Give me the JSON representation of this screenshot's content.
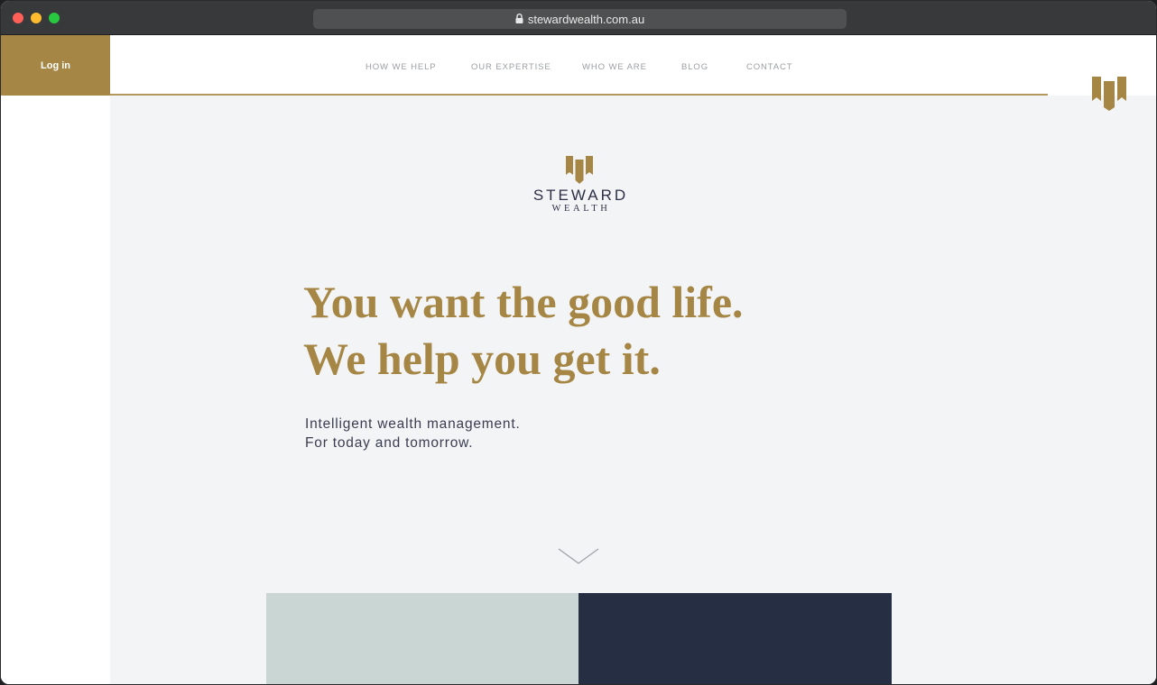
{
  "browser": {
    "url": "stewardwealth.com.au"
  },
  "header": {
    "login_label": "Log in",
    "nav": [
      {
        "label": "HOW WE HELP"
      },
      {
        "label": "OUR EXPERTISE"
      },
      {
        "label": "WHO WE ARE"
      },
      {
        "label": "BLOG"
      },
      {
        "label": "CONTACT"
      }
    ]
  },
  "brand": {
    "name_top": "STEWARD",
    "name_bottom": "WEALTH",
    "icon": "steward-bookmark-logo"
  },
  "hero": {
    "headline_line1": "You want the good life.",
    "headline_line2": "We help you get it.",
    "sub_line1": "Intelligent wealth management.",
    "sub_line2": "For today and tomorrow.",
    "scroll_icon": "chevron-down-icon"
  },
  "colors": {
    "gold": "#a68645",
    "navy": "#262e43",
    "sage": "#c9d6d3",
    "background": "#f3f4f6"
  }
}
